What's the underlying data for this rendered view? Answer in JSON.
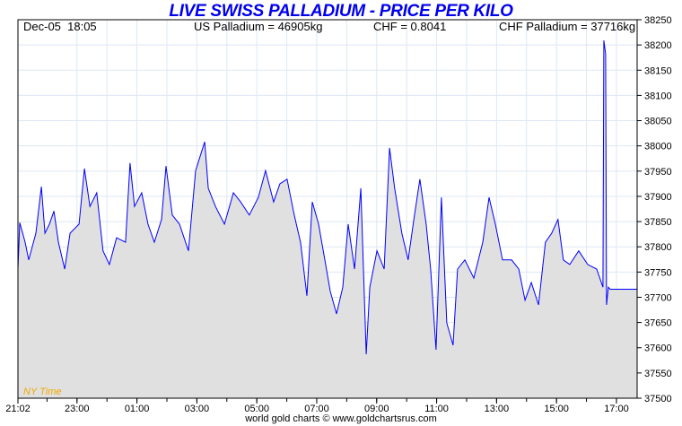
{
  "chart_data": {
    "type": "area",
    "title": "LIVE SWISS PALLADIUM - PRICE PER KILO",
    "header": {
      "datetime": "Dec-05  18:05",
      "us": "US Palladium = 46905kg",
      "fx": "CHF = 0.8041",
      "chf": "CHF Palladium = 37716kg"
    },
    "xlabel": "NY Time",
    "footer": "world gold charts © www.goldchartsrus.com",
    "ylim": [
      37500,
      38250
    ],
    "yticks": [
      37500,
      37550,
      37600,
      37650,
      37700,
      37750,
      37800,
      37850,
      37900,
      37950,
      38000,
      38050,
      38100,
      38150,
      38200,
      38250
    ],
    "xlim_hours": [
      0,
      20.66
    ],
    "xticks": [
      {
        "h": 0,
        "label": "21:02"
      },
      {
        "h": 1.97,
        "label": "23:00"
      },
      {
        "h": 3.97,
        "label": "01:00"
      },
      {
        "h": 5.97,
        "label": "03:00"
      },
      {
        "h": 7.97,
        "label": "05:00"
      },
      {
        "h": 9.97,
        "label": "07:00"
      },
      {
        "h": 11.97,
        "label": "09:00"
      },
      {
        "h": 13.97,
        "label": "11:00"
      },
      {
        "h": 15.97,
        "label": "13:00"
      },
      {
        "h": 17.97,
        "label": "15:00"
      },
      {
        "h": 19.97,
        "label": "17:00"
      }
    ],
    "line_color": "#0000ff",
    "fill_color": "#e0e0e0",
    "points": [
      [
        0,
        37756
      ],
      [
        0.06,
        37848
      ],
      [
        0.24,
        37809
      ],
      [
        0.36,
        37774
      ],
      [
        0.6,
        37827
      ],
      [
        0.78,
        37919
      ],
      [
        0.9,
        37827
      ],
      [
        1.05,
        37845
      ],
      [
        1.2,
        37871
      ],
      [
        1.35,
        37809
      ],
      [
        1.56,
        37756
      ],
      [
        1.74,
        37827
      ],
      [
        2.04,
        37845
      ],
      [
        2.22,
        37955
      ],
      [
        2.4,
        37880
      ],
      [
        2.63,
        37907
      ],
      [
        2.84,
        37792
      ],
      [
        3.05,
        37765
      ],
      [
        3.29,
        37818
      ],
      [
        3.59,
        37809
      ],
      [
        3.74,
        37966
      ],
      [
        3.89,
        37880
      ],
      [
        4.13,
        37907
      ],
      [
        4.34,
        37845
      ],
      [
        4.55,
        37809
      ],
      [
        4.79,
        37854
      ],
      [
        4.94,
        37960
      ],
      [
        5.15,
        37863
      ],
      [
        5.39,
        37845
      ],
      [
        5.69,
        37792
      ],
      [
        5.93,
        37951
      ],
      [
        6.23,
        38008
      ],
      [
        6.35,
        37916
      ],
      [
        6.59,
        37880
      ],
      [
        6.89,
        37845
      ],
      [
        7.19,
        37907
      ],
      [
        7.43,
        37889
      ],
      [
        7.72,
        37863
      ],
      [
        8.02,
        37898
      ],
      [
        8.26,
        37951
      ],
      [
        8.53,
        37889
      ],
      [
        8.74,
        37925
      ],
      [
        8.98,
        37934
      ],
      [
        9.22,
        37863
      ],
      [
        9.43,
        37809
      ],
      [
        9.64,
        37703
      ],
      [
        9.82,
        37889
      ],
      [
        10.03,
        37845
      ],
      [
        10.24,
        37774
      ],
      [
        10.42,
        37712
      ],
      [
        10.63,
        37667
      ],
      [
        10.84,
        37720
      ],
      [
        11.02,
        37845
      ],
      [
        11.23,
        37756
      ],
      [
        11.44,
        37916
      ],
      [
        11.62,
        37587
      ],
      [
        11.74,
        37720
      ],
      [
        11.98,
        37792
      ],
      [
        12.22,
        37756
      ],
      [
        12.4,
        37996
      ],
      [
        12.57,
        37916
      ],
      [
        12.81,
        37827
      ],
      [
        13.02,
        37774
      ],
      [
        13.23,
        37863
      ],
      [
        13.41,
        37934
      ],
      [
        13.62,
        37845
      ],
      [
        13.77,
        37756
      ],
      [
        13.95,
        37596
      ],
      [
        14.13,
        37898
      ],
      [
        14.31,
        37649
      ],
      [
        14.52,
        37605
      ],
      [
        14.67,
        37756
      ],
      [
        14.91,
        37774
      ],
      [
        15.21,
        37738
      ],
      [
        15.51,
        37809
      ],
      [
        15.72,
        37898
      ],
      [
        15.93,
        37845
      ],
      [
        16.17,
        37774
      ],
      [
        16.47,
        37774
      ],
      [
        16.71,
        37756
      ],
      [
        16.92,
        37694
      ],
      [
        17.13,
        37729
      ],
      [
        17.37,
        37685
      ],
      [
        17.6,
        37809
      ],
      [
        17.81,
        37827
      ],
      [
        18.02,
        37854
      ],
      [
        18.2,
        37774
      ],
      [
        18.41,
        37765
      ],
      [
        18.71,
        37792
      ],
      [
        19.01,
        37765
      ],
      [
        19.31,
        37756
      ],
      [
        19.52,
        37720
      ],
      [
        19.55,
        38209
      ],
      [
        19.61,
        38182
      ],
      [
        19.64,
        37685
      ],
      [
        19.7,
        37720
      ],
      [
        19.76,
        37716
      ],
      [
        20.66,
        37716
      ]
    ]
  }
}
